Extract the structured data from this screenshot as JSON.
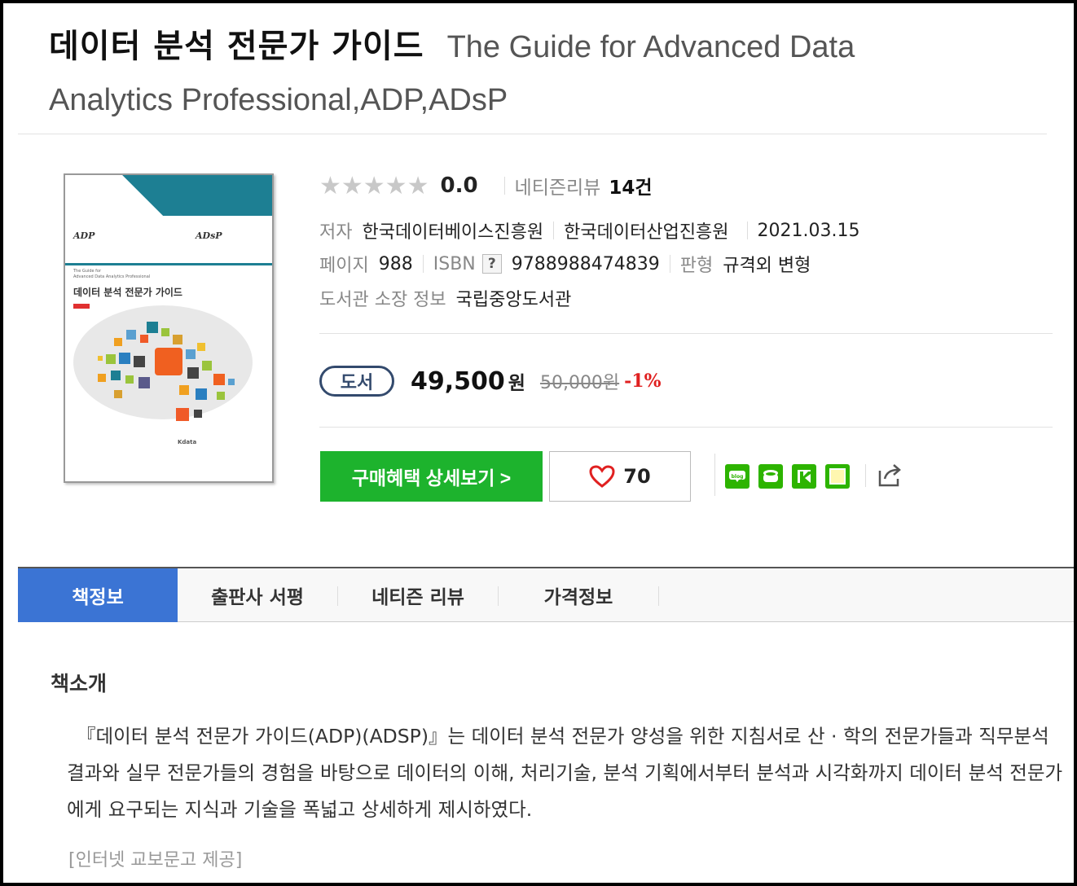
{
  "title": {
    "korean": "데이터 분석 전문가 가이드",
    "english_line1": "The Guide for Advanced Data",
    "english_line2": "Analytics Professional,ADP,ADsP"
  },
  "cover": {
    "logo_left": "ADP",
    "logo_right": "ADsP",
    "small_text_1": "The Guide for",
    "small_text_2": "Advanced Data Analytics Professional",
    "title": "데이터 분석 전문가 가이드",
    "publisher_logo": "Kdata"
  },
  "rating": {
    "stars": "★★★★★",
    "stars_filled": 0,
    "score": "0.0",
    "review_label": "네티즌리뷰",
    "review_count": "14건"
  },
  "meta": {
    "author_label": "저자",
    "author1": "한국데이터베이스진흥원",
    "author2": "한국데이터산업진흥원",
    "date": "2021.03.15",
    "pages_label": "페이지",
    "pages": "988",
    "isbn_label": "ISBN",
    "isbn_help": "?",
    "isbn": "9788988474839",
    "format_label": "판형",
    "format": "규격외 변형",
    "library_label": "도서관 소장 정보",
    "library": "국립중앙도서관"
  },
  "price": {
    "badge": "도서",
    "sale_price": "49,500",
    "currency": "원",
    "original_price": "50,000원",
    "discount": "-1%"
  },
  "actions": {
    "buy_label": "구매혜택 상세보기 >",
    "like_count": "70"
  },
  "tabs": [
    {
      "label": "책정보",
      "active": true
    },
    {
      "label": "출판사 서평",
      "active": false
    },
    {
      "label": "네티즌 리뷰",
      "active": false
    },
    {
      "label": "가격정보",
      "active": false
    }
  ],
  "intro": {
    "heading": "책소개",
    "body": "『데이터 분석 전문가 가이드(ADP)(ADSP)』는 데이터 분석 전문가 양성을 위한 지침서로 산 · 학의 전문가들과 직무분석 결과와 실무 전문가들의 경험을 바탕으로 데이터의 이해, 처리기술, 분석 기획에서부터 분석과 시각화까지 데이터 분석 전문가에게 요구되는 지식과 기술을 폭넓고 상세하게 제시하였다.",
    "source": "[인터넷 교보문고 제공]"
  },
  "colors": {
    "buy_green": "#1db32d",
    "tab_active": "#3b74d4",
    "badge_navy": "#334a6d",
    "discount_red": "#e02020",
    "cover_teal": "#1d7f93"
  },
  "icons": [
    "blog-share-icon",
    "cafe-share-icon",
    "kakao-share-icon",
    "memo-share-icon",
    "share-icon",
    "heart-icon",
    "star-icon"
  ]
}
